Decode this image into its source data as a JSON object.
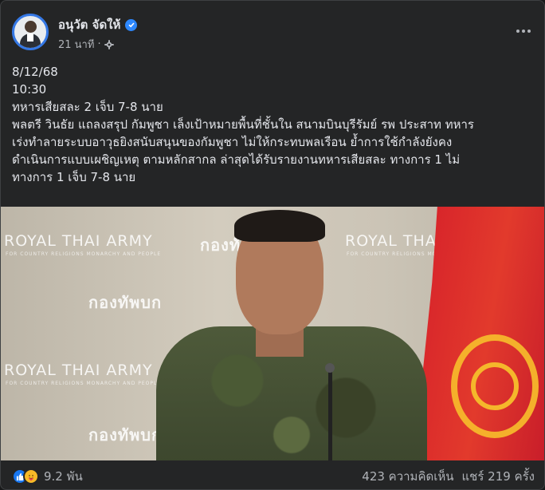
{
  "post": {
    "author": "อนุวัต จัดให้",
    "time": "21 นาที",
    "separator": "·",
    "lines": [
      "8/12/68",
      "10:30",
      "ทหารเสียสละ 2 เจ็บ 7-8 นาย",
      "พลตรี วินธัย  แถลงสรุป กัมพูชา เล็งเป้าหมายพื้นที่ชั้นใน สนามบินบุรีรัมย์ รพ ประสาท ทหาร",
      "เร่งทำลายระบบอาวุธยิงสนับสนุนของกัมพูชา ไม่ให้กระทบพลเรือน  ย้ำการใช้กำลังยังคง",
      "ดำเนินการแบบเผชิญเหตุ ตามหลักสากล ล่าสุดได้รับรายงานทหารเสียสละ ทางการ 1  ไม่",
      "ทางการ 1  เจ็บ 7-8 นาย"
    ]
  },
  "media": {
    "watermarks": {
      "army_en": "ROYAL THAI ARMY",
      "army_th": "กองทัพบก",
      "motto": "FOR COUNTRY RELIGIONS MONARCHY AND PEOPLE"
    }
  },
  "footer": {
    "reaction_count": "9.2 พัน",
    "comments": "423 ความคิดเห็น",
    "shares": "แชร์ 219 ครั้ง"
  },
  "icons": {
    "verified": "verified-badge-icon",
    "privacy": "gear-icon",
    "more": "more-options-icon",
    "like": "like-icon",
    "care": "care-icon"
  },
  "colors": {
    "background": "#242526",
    "text": "#e4e6eb",
    "muted": "#b0b3b8",
    "accent": "#2d88ff",
    "like": "#1877f2",
    "care": "#f7b928"
  }
}
